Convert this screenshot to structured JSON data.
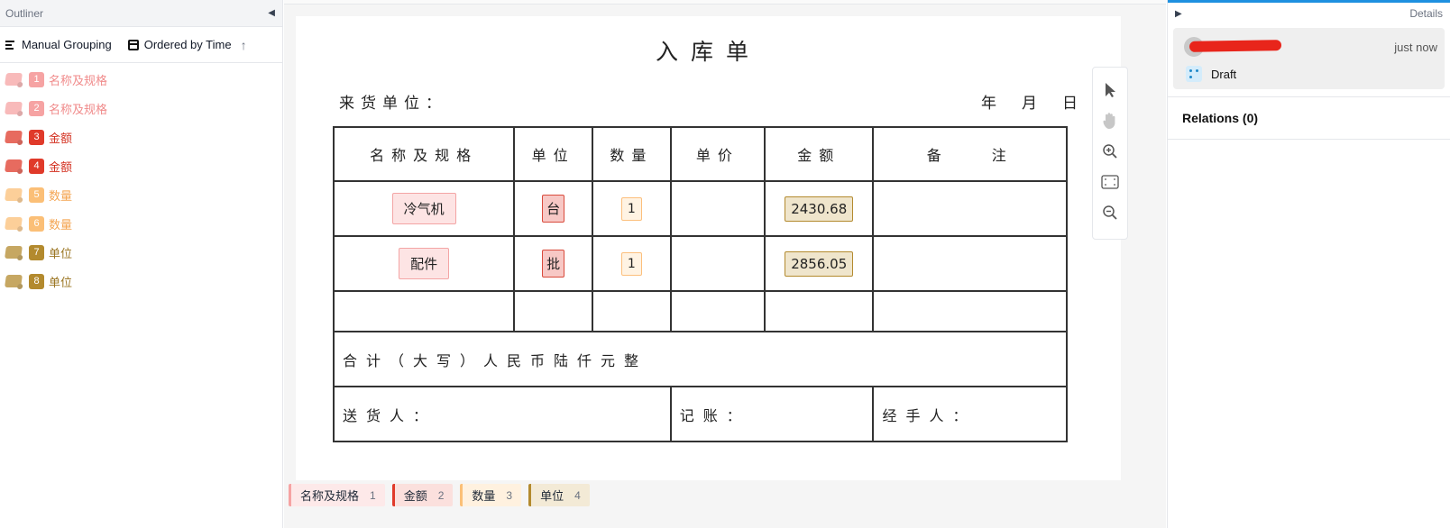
{
  "outliner": {
    "title": "Outliner",
    "grouping_label": "Manual Grouping",
    "ordering_label": "Ordered by Time",
    "items": [
      {
        "num": "1",
        "label": "名称及规格",
        "color": "#f6a3a3",
        "text_color": "#f08a8a"
      },
      {
        "num": "2",
        "label": "名称及规格",
        "color": "#f6a3a3",
        "text_color": "#f08a8a"
      },
      {
        "num": "3",
        "label": "金额",
        "color": "#e03a2a",
        "text_color": "#d32f1f"
      },
      {
        "num": "4",
        "label": "金额",
        "color": "#e03a2a",
        "text_color": "#d32f1f"
      },
      {
        "num": "5",
        "label": "数量",
        "color": "#fbbf77",
        "text_color": "#f4a552"
      },
      {
        "num": "6",
        "label": "数量",
        "color": "#fbbf77",
        "text_color": "#f4a552"
      },
      {
        "num": "7",
        "label": "单位",
        "color": "#b38a2e",
        "text_color": "#9a7420"
      },
      {
        "num": "8",
        "label": "单位",
        "color": "#b38a2e",
        "text_color": "#9a7420"
      }
    ]
  },
  "document": {
    "title": "入库单",
    "supplier_label": "来货单位：",
    "date_year": "年",
    "date_month": "月",
    "date_day": "日",
    "headers": [
      "名称及规格",
      "单位",
      "数量",
      "单价",
      "金额",
      "备　　注"
    ],
    "rows": [
      {
        "name": "冷气机",
        "unit": "台",
        "qty": "1",
        "price": "",
        "amount": "2430.68",
        "remark": ""
      },
      {
        "name": "配件",
        "unit": "批",
        "qty": "1",
        "price": "",
        "amount": "2856.05",
        "remark": ""
      }
    ],
    "total_label": "合计（大写）人民币陆仟元整",
    "deliverer_label": "送货人：",
    "bookkeeper_label": "记账：",
    "handler_label": "经手人："
  },
  "legend": [
    {
      "label": "名称及规格",
      "count": "1",
      "color": "#f6a3a3",
      "bg": "#fde9e9"
    },
    {
      "label": "金额",
      "count": "2",
      "color": "#e03a2a",
      "bg": "#fbe0dd"
    },
    {
      "label": "数量",
      "count": "3",
      "color": "#fbbf77",
      "bg": "#fff1df"
    },
    {
      "label": "单位",
      "count": "4",
      "color": "#b38a2e",
      "bg": "#f3ead6"
    }
  ],
  "details": {
    "title": "Details",
    "time": "just now",
    "status": "Draft",
    "relations_label": "Relations (0)"
  }
}
